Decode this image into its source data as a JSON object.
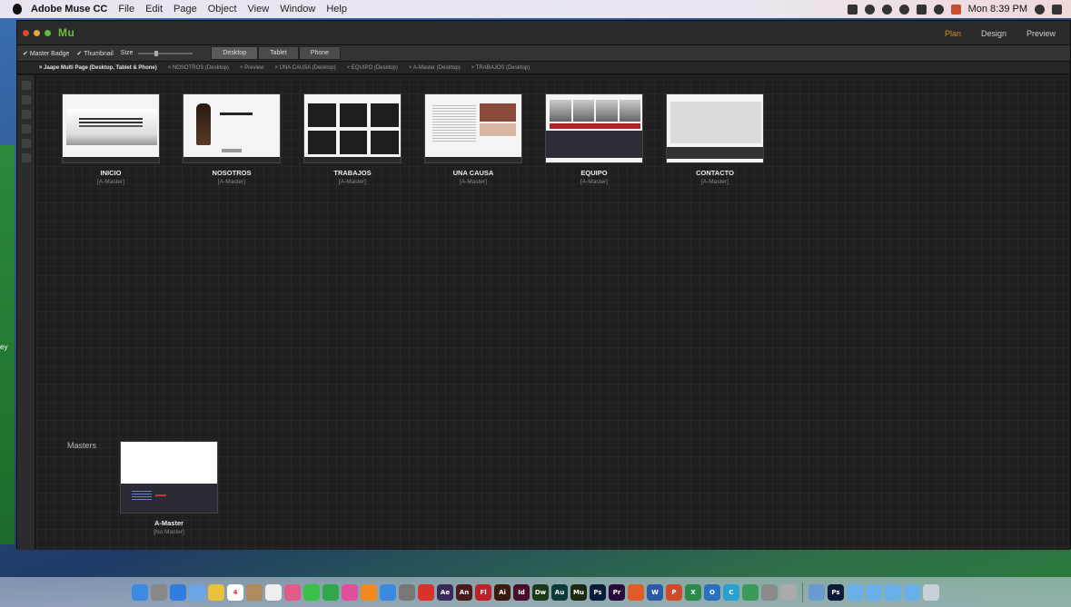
{
  "menubar": {
    "app_name": "Adobe Muse CC",
    "menus": [
      "File",
      "Edit",
      "Page",
      "Object",
      "View",
      "Window",
      "Help"
    ],
    "clock": "Mon 8:39 PM"
  },
  "window": {
    "logo": "Mu",
    "modes": [
      "Plan",
      "Design",
      "Preview"
    ],
    "active_mode": "Plan"
  },
  "toolbar": {
    "master_badge_label": "Master Badge",
    "thumbnail_label": "Thumbnail",
    "size_label": "Size",
    "views": [
      "Desktop",
      "Tablet",
      "Phone"
    ],
    "active_view": "Desktop"
  },
  "tabs": [
    "Jaape Multi Page (Desktop, Tablet & Phone)",
    "NOSOTROS (Desktop)",
    "Preview",
    "UNA CAUSA (Desktop)",
    "EQUIPO (Desktop)",
    "A-Master (Desktop)",
    "TRABAJOS (Desktop)"
  ],
  "pages": [
    {
      "name": "INICIO",
      "master": "[A-Master]"
    },
    {
      "name": "NOSOTROS",
      "master": "[A-Master]"
    },
    {
      "name": "TRABAJOS",
      "master": "[A-Master]"
    },
    {
      "name": "UNA CAUSA",
      "master": "[A-Master]"
    },
    {
      "name": "EQUIPO",
      "master": "[A-Master]"
    },
    {
      "name": "CONTACTO",
      "master": "[A-Master]"
    }
  ],
  "masters": {
    "label": "Masters",
    "items": [
      {
        "name": "A-Master",
        "master": "[No Master]"
      }
    ]
  },
  "desktop_label": "ey",
  "dock": {
    "apps": [
      {
        "name": "finder",
        "label": "",
        "color": "#3d8be0"
      },
      {
        "name": "launchpad",
        "label": "",
        "color": "#888"
      },
      {
        "name": "safari",
        "label": "",
        "color": "#2e7de0"
      },
      {
        "name": "mail",
        "label": "",
        "color": "#6aa6e6"
      },
      {
        "name": "notes",
        "label": "",
        "color": "#e8c23a"
      },
      {
        "name": "calendar",
        "label": "4",
        "color": "#ffffff"
      },
      {
        "name": "contacts",
        "label": "",
        "color": "#b08a5a"
      },
      {
        "name": "reminders",
        "label": "",
        "color": "#eee"
      },
      {
        "name": "photos",
        "label": "",
        "color": "#e05a8a"
      },
      {
        "name": "messages",
        "label": "",
        "color": "#3ac04a"
      },
      {
        "name": "facetime",
        "label": "",
        "color": "#2fa84a"
      },
      {
        "name": "itunes",
        "label": "",
        "color": "#e0509a"
      },
      {
        "name": "ibooks",
        "label": "",
        "color": "#f08a20"
      },
      {
        "name": "app-store",
        "label": "",
        "color": "#3a8ae0"
      },
      {
        "name": "system-preferences",
        "label": "",
        "color": "#777"
      },
      {
        "name": "acrobat",
        "label": "",
        "color": "#d9322a"
      },
      {
        "name": "after-effects",
        "label": "Ae",
        "color": "#3a2a5a"
      },
      {
        "name": "animate",
        "label": "An",
        "color": "#4a1a1a"
      },
      {
        "name": "flash",
        "label": "Fl",
        "color": "#c0202a"
      },
      {
        "name": "illustrator",
        "label": "Ai",
        "color": "#3a1a08"
      },
      {
        "name": "indesign",
        "label": "Id",
        "color": "#4a0a2a"
      },
      {
        "name": "dreamweaver",
        "label": "Dw",
        "color": "#1a3a1a"
      },
      {
        "name": "audition",
        "label": "Au",
        "color": "#0a3a3a"
      },
      {
        "name": "muse",
        "label": "Mu",
        "color": "#1a2a10"
      },
      {
        "name": "photoshop",
        "label": "Ps",
        "color": "#0a1a3a"
      },
      {
        "name": "premiere",
        "label": "Pr",
        "color": "#2a0a3a"
      },
      {
        "name": "app-a",
        "label": "",
        "color": "#e05a2a"
      },
      {
        "name": "word",
        "label": "W",
        "color": "#2a5aa8"
      },
      {
        "name": "powerpoint",
        "label": "P",
        "color": "#d04a2a"
      },
      {
        "name": "excel",
        "label": "X",
        "color": "#2a8a4a"
      },
      {
        "name": "outlook",
        "label": "O",
        "color": "#2a70c0"
      },
      {
        "name": "app-c",
        "label": "C",
        "color": "#2aa0d0"
      },
      {
        "name": "app-d",
        "label": "",
        "color": "#3a9a5a"
      },
      {
        "name": "app-e",
        "label": "",
        "color": "#8a8a8a"
      },
      {
        "name": "app-f",
        "label": "",
        "color": "#aaaaaa"
      },
      {
        "name": "preview",
        "label": "",
        "color": "#6a9ad0"
      },
      {
        "name": "photoshop-doc",
        "label": "Ps",
        "color": "#0a1a3a"
      },
      {
        "name": "folder-a",
        "label": "",
        "color": "#6ab0e8"
      },
      {
        "name": "folder-b",
        "label": "",
        "color": "#6ab0e8"
      },
      {
        "name": "folder-c",
        "label": "",
        "color": "#6ab0e8"
      },
      {
        "name": "folder-d",
        "label": "",
        "color": "#6ab0e8"
      },
      {
        "name": "trash",
        "label": "",
        "color": "#c8d0d8"
      }
    ]
  }
}
